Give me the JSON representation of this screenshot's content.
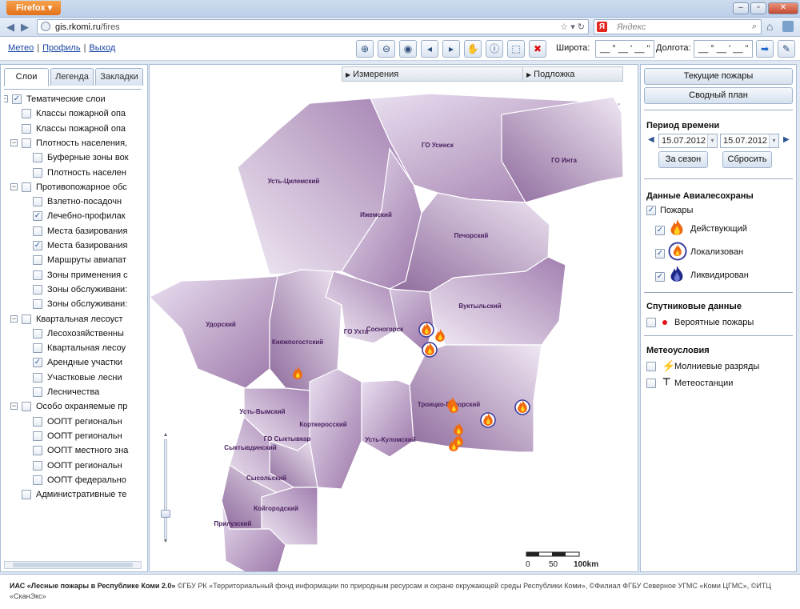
{
  "browser": {
    "app_button": "Firefox",
    "url_host": "gis.rkomi.ru",
    "url_path": "/fires",
    "search_placeholder": "Яндекс",
    "search_engine_letter": "Я"
  },
  "toolbar": {
    "links": [
      "Метео",
      "Профиль",
      "Выход"
    ],
    "lat_label": "Широта:",
    "lon_label": "Долгота:",
    "lat_value": "__ ° __ ' __ \"",
    "lon_value": "__ ° __ ' __ \""
  },
  "left": {
    "tabs": [
      "Слои",
      "Легенда",
      "Закладки"
    ],
    "tree": [
      {
        "label": "Тематические слои",
        "level": 0,
        "toggle": "−",
        "checked": true
      },
      {
        "label": "Классы пожарной опа",
        "level": 1,
        "checked": false
      },
      {
        "label": "Классы пожарной опа",
        "level": 1,
        "checked": false
      },
      {
        "label": "Плотность населения,",
        "level": 1,
        "toggle": "−",
        "checked": false
      },
      {
        "label": "Буферные зоны вок",
        "level": 2,
        "checked": false
      },
      {
        "label": "Плотность населен",
        "level": 2,
        "checked": false
      },
      {
        "label": "Противопожарное обс",
        "level": 1,
        "toggle": "−",
        "checked": false
      },
      {
        "label": "Взлетно-посадочн",
        "level": 2,
        "checked": false
      },
      {
        "label": "Лечебно-профилак",
        "level": 2,
        "checked": true
      },
      {
        "label": "Места базирования",
        "level": 2,
        "checked": false
      },
      {
        "label": "Места базирования",
        "level": 2,
        "checked": true
      },
      {
        "label": "Маршруты авиапат",
        "level": 2,
        "checked": false
      },
      {
        "label": "Зоны применения с",
        "level": 2,
        "checked": false
      },
      {
        "label": "Зоны обслуживани:",
        "level": 2,
        "checked": false
      },
      {
        "label": "Зоны обслуживани:",
        "level": 2,
        "checked": false
      },
      {
        "label": "Квартальная лесоуст",
        "level": 1,
        "toggle": "−",
        "checked": false
      },
      {
        "label": "Лесохозяйственны",
        "level": 2,
        "checked": false
      },
      {
        "label": "Квартальная лесоу",
        "level": 2,
        "checked": false
      },
      {
        "label": "Арендные участки",
        "level": 2,
        "checked": true
      },
      {
        "label": "Участковые лесни",
        "level": 2,
        "checked": false
      },
      {
        "label": "Лесничества",
        "level": 2,
        "checked": false
      },
      {
        "label": "Особо охраняемые пр",
        "level": 1,
        "toggle": "−",
        "checked": false
      },
      {
        "label": "ООПТ региональн",
        "level": 2,
        "checked": false
      },
      {
        "label": "ООПТ региональн",
        "level": 2,
        "checked": false
      },
      {
        "label": "ООПТ местного зна",
        "level": 2,
        "checked": false
      },
      {
        "label": "ООПТ региональн",
        "level": 2,
        "checked": false
      },
      {
        "label": "ООПТ федерально",
        "level": 2,
        "checked": false
      },
      {
        "label": "Административные те",
        "level": 1,
        "checked": false
      }
    ]
  },
  "map": {
    "bar_measure": "Измерения",
    "bar_base": "Подложка",
    "region_fill": "#a57fae",
    "regions": [
      "ГО Усинск",
      "ГО Инта",
      "Усть-Цилемский",
      "Ижемский",
      "Печорский",
      "Вуктыльский",
      "Удорский",
      "Княжпогостский",
      "ГО Ухта",
      "Сосногорск",
      "Троицко-Печорский",
      "Усть-Вымский",
      "Корткеросский",
      "ГО Сыктывкар",
      "Сыктывдинский",
      "Усть-Куломский",
      "Сысольский",
      "Койгородский",
      "Прилузский"
    ],
    "scale": [
      "0",
      "50",
      "100km"
    ]
  },
  "right": {
    "btn_current": "Текущие пожары",
    "btn_summary": "Сводный план",
    "period_title": "Период времени",
    "date_from": "15.07.2012",
    "date_to": "15.07.2012",
    "btn_season": "За сезон",
    "btn_reset": "Сбросить",
    "avia_title": "Данные Авиалесохраны",
    "fires_label": "Пожары",
    "fire_active": "Действующий",
    "fire_localized": "Локализован",
    "fire_liquidated": "Ликвидирован",
    "sat_title": "Спутниковые данные",
    "sat_item": "Вероятные пожары",
    "meteo_title": "Метеоусловия",
    "meteo_lightning": "Молниевые разряды",
    "meteo_stations": "Метеостанции"
  },
  "footer": {
    "org": "ИАС «Лесные пожары в Республике Коми 2.0»",
    "credits": " ©ГБУ РК «Территориальный фонд информации по природным ресурсам и охране окружающей среды Республики Коми», ©Филиал ФГБУ Северное УГМС «Коми ЦГМС», ©ИТЦ «СканЭкс»"
  }
}
